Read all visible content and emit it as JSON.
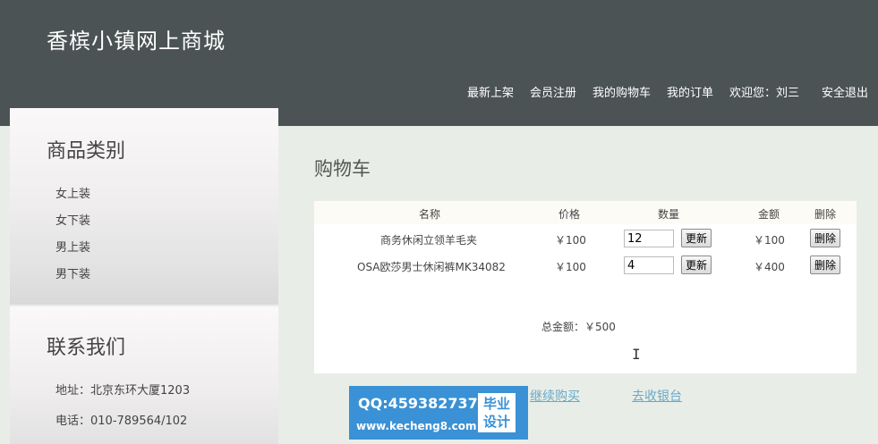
{
  "site": {
    "title": "香槟小镇网上商城"
  },
  "nav": {
    "items": [
      "最新上架",
      "会员注册",
      "我的购物车",
      "我的订单",
      "欢迎您：刘三",
      "安全退出"
    ]
  },
  "sidebar": {
    "category_title": "商品类别",
    "categories": [
      "女上装",
      "女下装",
      "男上装",
      "男下装"
    ],
    "contact_title": "联系我们",
    "contact": {
      "address": "地址：北京东环大厦1203",
      "phone": "电话：010-789564/102"
    }
  },
  "main": {
    "title": "购物车",
    "columns": [
      "名称",
      "价格",
      "数量",
      "金额",
      "删除"
    ],
    "rows": [
      {
        "name": "商务休闲立领羊毛夹",
        "price": "￥100",
        "qty": "12",
        "update": "更新",
        "amount": "￥100",
        "delete": "删除"
      },
      {
        "name": "OSA欧莎男士休闲裤MK34082",
        "price": "￥100",
        "qty": "4",
        "update": "更新",
        "amount": "￥400",
        "delete": "删除"
      }
    ],
    "total": "总金额：￥500"
  },
  "links": {
    "continue": "继续购买",
    "checkout": "去收银台"
  },
  "ad": {
    "qq": "QQ:459382737",
    "url": "www.kecheng8.com",
    "badge_line1": "毕业",
    "badge_line2": "设计"
  }
}
